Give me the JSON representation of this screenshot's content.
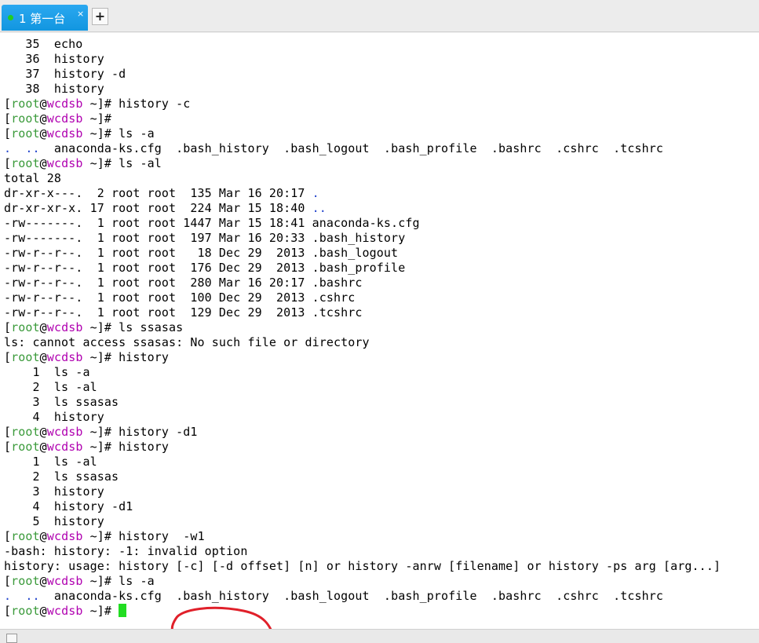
{
  "tabs": [
    {
      "label": "1 第一台",
      "close": "×",
      "active": true
    }
  ],
  "new_tab_label": "+",
  "prompt": {
    "open": "[",
    "user": "root",
    "at": "@",
    "host": "wcdsb",
    "tail": " ~]# "
  },
  "terminal_lines": [
    [
      "t",
      "   35  echo"
    ],
    [
      "t",
      "   36  history"
    ],
    [
      "t",
      "   37  history -d"
    ],
    [
      "t",
      "   38  history"
    ],
    [
      "p",
      "history -c"
    ],
    [
      "p",
      ""
    ],
    [
      "p",
      "ls -a"
    ],
    [
      "ls",
      ".  ..  anaconda-ks.cfg  .bash_history  .bash_logout  .bash_profile  .bashrc  .cshrc  .tcshrc"
    ],
    [
      "p",
      "ls -al"
    ],
    [
      "t",
      "total 28"
    ],
    [
      "ll",
      "dr-xr-x---.  2 root root  135 Mar 16 20:17 ",
      "."
    ],
    [
      "ll",
      "dr-xr-xr-x. 17 root root  224 Mar 15 18:40 ",
      ".."
    ],
    [
      "t",
      "-rw-------.  1 root root 1447 Mar 15 18:41 anaconda-ks.cfg"
    ],
    [
      "t",
      "-rw-------.  1 root root  197 Mar 16 20:33 .bash_history"
    ],
    [
      "t",
      "-rw-r--r--.  1 root root   18 Dec 29  2013 .bash_logout"
    ],
    [
      "t",
      "-rw-r--r--.  1 root root  176 Dec 29  2013 .bash_profile"
    ],
    [
      "t",
      "-rw-r--r--.  1 root root  280 Mar 16 20:17 .bashrc"
    ],
    [
      "t",
      "-rw-r--r--.  1 root root  100 Dec 29  2013 .cshrc"
    ],
    [
      "t",
      "-rw-r--r--.  1 root root  129 Dec 29  2013 .tcshrc"
    ],
    [
      "p",
      "ls ssasas"
    ],
    [
      "t",
      "ls: cannot access ssasas: No such file or directory"
    ],
    [
      "p",
      "history"
    ],
    [
      "t",
      "    1  ls -a"
    ],
    [
      "t",
      "    2  ls -al"
    ],
    [
      "t",
      "    3  ls ssasas"
    ],
    [
      "t",
      "    4  history"
    ],
    [
      "p",
      "history -d1"
    ],
    [
      "p",
      "history"
    ],
    [
      "t",
      "    1  ls -al"
    ],
    [
      "t",
      "    2  ls ssasas"
    ],
    [
      "t",
      "    3  history"
    ],
    [
      "t",
      "    4  history -d1"
    ],
    [
      "t",
      "    5  history"
    ],
    [
      "p",
      "history  -w1"
    ],
    [
      "t",
      "-bash: history: -1: invalid option"
    ],
    [
      "t",
      "history: usage: history [-c] [-d offset] [n] or history -anrw [filename] or history -ps arg [arg...]"
    ],
    [
      "p",
      "ls -a"
    ],
    [
      "ls",
      ".  ..  anaconda-ks.cfg  .bash_history  .bash_logout  .bash_profile  .bashrc  .cshrc  .tcshrc"
    ],
    [
      "pc",
      ""
    ]
  ],
  "colors": {
    "tab_active": "#1a9be6",
    "prompt_user": "#3a9a3a",
    "prompt_host": "#b000b0",
    "dir_color": "#2244cc",
    "cursor": "#22dd22",
    "annotation": "#e0202a"
  },
  "icons": {
    "tab_status": "green-dot-icon",
    "close": "close-icon",
    "new_tab": "plus-icon"
  }
}
